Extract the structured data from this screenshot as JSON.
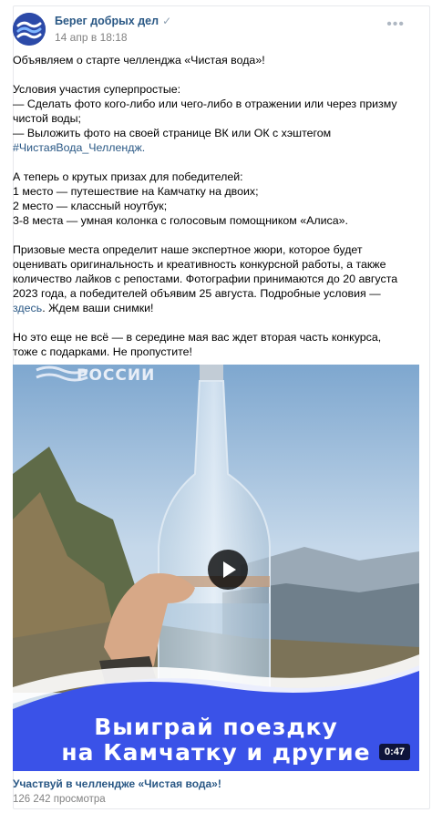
{
  "post": {
    "author": "Берег добрых дел",
    "date": "14 апр в 18:18",
    "more_icon": "more-horizontal-icon",
    "verified_icon": "checkmark-icon",
    "colors": {
      "link": "#2a5885",
      "muted": "#828282",
      "banner": "#3a52e8"
    },
    "text": {
      "intro": "Объявляем о старте челленджа «Чистая вода»!",
      "conditions_title": "Условия участия суперпростые:",
      "condition_1": "— Сделать фото кого-либо или чего-либо в отражении или через призму чистой воды;",
      "condition_2": "— Выложить фото на своей странице ВК или ОК с хэштегом",
      "hashtag": "#ЧистаяВода_Челлендж.",
      "prizes_title": "А теперь о крутых призах для победителей:",
      "prize_1": "1 место — путешествие на Камчатку на двоих;",
      "prize_2": "2 место — классный ноутбук;",
      "prize_3": "3-8 места — умная колонка с голосовым помощником «Алиса».",
      "jury_text": "Призовые места определит наше экспертное жюри, которое будет оценивать оригинальность и креативность конкурсной работы, а также количество лайков с репостами. Фотографии принимаются до 20 августа 2023 года, а победителей объявим 25 августа. Подробные условия — ",
      "here_link": "здесь",
      "jury_tail": ". Ждем ваши снимки!",
      "outro": "Но это еще не всё — в середине мая вас ждет вторая часть конкурса, тоже с подарками. Не пропустите!"
    },
    "video": {
      "logo_text": "РОССИИ",
      "banner_line_1": "Выиграй поездку",
      "banner_line_2": "на Камчатку и другие",
      "duration": "0:47",
      "play_icon": "play-icon",
      "title": "Участвуй в челлендже «Чистая вода»!",
      "views": "126 242 просмотра"
    }
  }
}
